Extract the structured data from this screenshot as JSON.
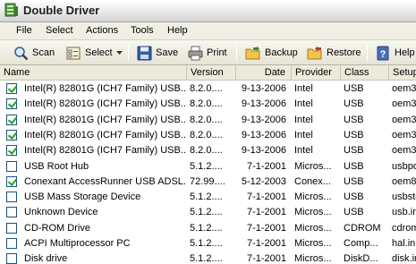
{
  "window": {
    "title": "Double Driver"
  },
  "menu": [
    "File",
    "Select",
    "Actions",
    "Tools",
    "Help"
  ],
  "toolbar": {
    "scan": "Scan",
    "select": "Select",
    "save": "Save",
    "print": "Print",
    "backup": "Backup",
    "restore": "Restore",
    "help": "Help"
  },
  "columns": {
    "name": "Name",
    "version": "Version",
    "date": "Date",
    "provider": "Provider",
    "class": "Class",
    "setup": "Setup"
  },
  "drivers": [
    {
      "checked": true,
      "name": "Intel(R) 82801G (ICH7 Family) USB...",
      "version": "8.2.0....",
      "date": "9-13-2006",
      "provider": "Intel",
      "class": "USB",
      "setup": "oem3"
    },
    {
      "checked": true,
      "name": "Intel(R) 82801G (ICH7 Family) USB...",
      "version": "8.2.0....",
      "date": "9-13-2006",
      "provider": "Intel",
      "class": "USB",
      "setup": "oem3"
    },
    {
      "checked": true,
      "name": "Intel(R) 82801G (ICH7 Family) USB...",
      "version": "8.2.0....",
      "date": "9-13-2006",
      "provider": "Intel",
      "class": "USB",
      "setup": "oem3"
    },
    {
      "checked": true,
      "name": "Intel(R) 82801G (ICH7 Family) USB...",
      "version": "8.2.0....",
      "date": "9-13-2006",
      "provider": "Intel",
      "class": "USB",
      "setup": "oem3"
    },
    {
      "checked": true,
      "name": "Intel(R) 82801G (ICH7 Family) USB...",
      "version": "8.2.0....",
      "date": "9-13-2006",
      "provider": "Intel",
      "class": "USB",
      "setup": "oem3"
    },
    {
      "checked": false,
      "name": "USB Root Hub",
      "version": "5.1.2....",
      "date": "7-1-2001",
      "provider": "Micros...",
      "class": "USB",
      "setup": "usbpo"
    },
    {
      "checked": true,
      "name": "Conexant AccessRunner USB ADSL...",
      "version": "72.99....",
      "date": "5-12-2003",
      "provider": "Conex...",
      "class": "USB",
      "setup": "oem8"
    },
    {
      "checked": false,
      "name": "USB Mass Storage Device",
      "version": "5.1.2....",
      "date": "7-1-2001",
      "provider": "Micros...",
      "class": "USB",
      "setup": "usbsto"
    },
    {
      "checked": false,
      "name": "Unknown Device",
      "version": "5.1.2....",
      "date": "7-1-2001",
      "provider": "Micros...",
      "class": "USB",
      "setup": "usb.in"
    },
    {
      "checked": false,
      "name": "CD-ROM Drive",
      "version": "5.1.2....",
      "date": "7-1-2001",
      "provider": "Micros...",
      "class": "CDROM",
      "setup": "cdrom"
    },
    {
      "checked": false,
      "name": "ACPI Multiprocessor PC",
      "version": "5.1.2....",
      "date": "7-1-2001",
      "provider": "Micros...",
      "class": "Comp...",
      "setup": "hal.in"
    },
    {
      "checked": false,
      "name": "Disk drive",
      "version": "5.1.2....",
      "date": "7-1-2001",
      "provider": "Micros...",
      "class": "DiskD...",
      "setup": "disk.in"
    }
  ],
  "colors": {
    "check": "#21a121",
    "chrome": "#ece9d8"
  }
}
